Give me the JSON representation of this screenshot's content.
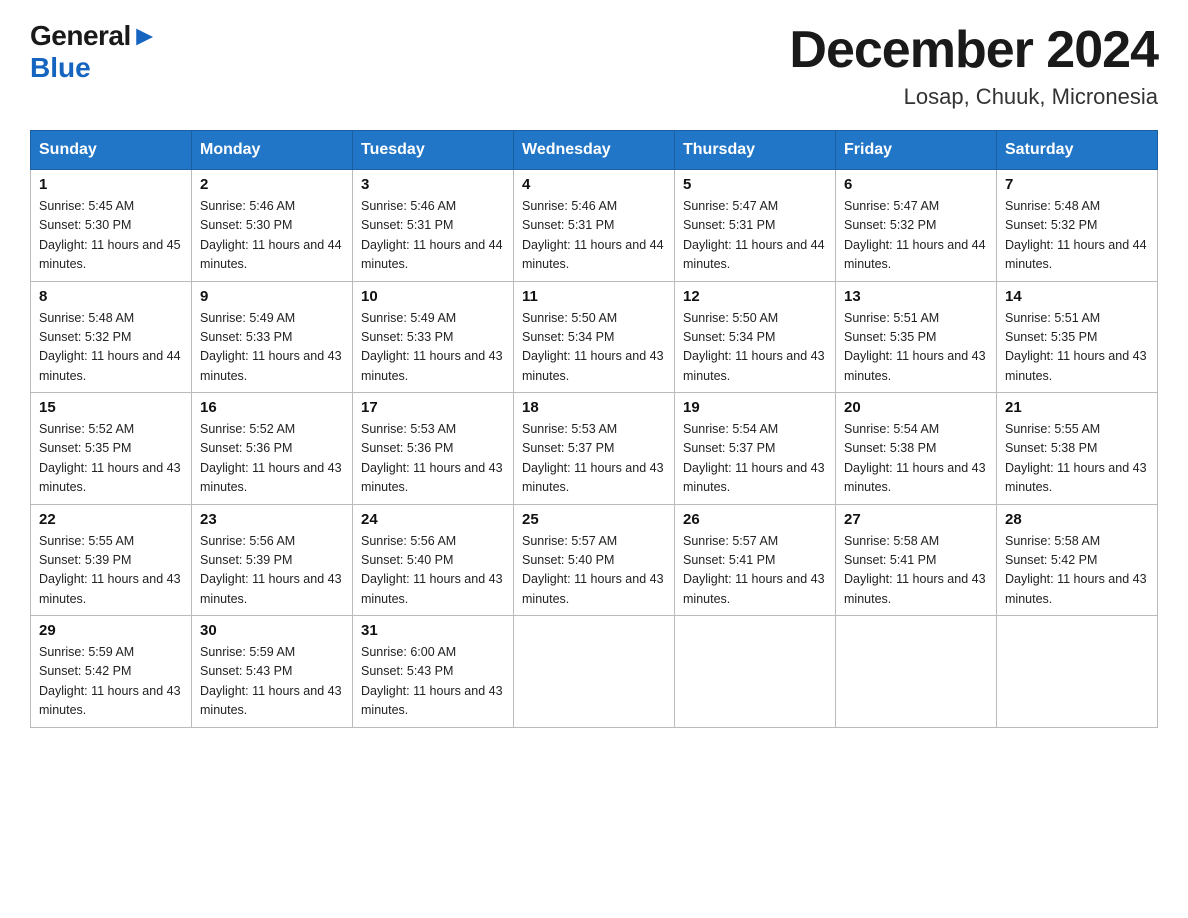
{
  "header": {
    "logo_general": "General",
    "logo_blue": "Blue",
    "month_year": "December 2024",
    "location": "Losap, Chuuk, Micronesia"
  },
  "days_of_week": [
    "Sunday",
    "Monday",
    "Tuesday",
    "Wednesday",
    "Thursday",
    "Friday",
    "Saturday"
  ],
  "weeks": [
    [
      {
        "day": "1",
        "sunrise": "5:45 AM",
        "sunset": "5:30 PM",
        "daylight": "11 hours and 45 minutes."
      },
      {
        "day": "2",
        "sunrise": "5:46 AM",
        "sunset": "5:30 PM",
        "daylight": "11 hours and 44 minutes."
      },
      {
        "day": "3",
        "sunrise": "5:46 AM",
        "sunset": "5:31 PM",
        "daylight": "11 hours and 44 minutes."
      },
      {
        "day": "4",
        "sunrise": "5:46 AM",
        "sunset": "5:31 PM",
        "daylight": "11 hours and 44 minutes."
      },
      {
        "day": "5",
        "sunrise": "5:47 AM",
        "sunset": "5:31 PM",
        "daylight": "11 hours and 44 minutes."
      },
      {
        "day": "6",
        "sunrise": "5:47 AM",
        "sunset": "5:32 PM",
        "daylight": "11 hours and 44 minutes."
      },
      {
        "day": "7",
        "sunrise": "5:48 AM",
        "sunset": "5:32 PM",
        "daylight": "11 hours and 44 minutes."
      }
    ],
    [
      {
        "day": "8",
        "sunrise": "5:48 AM",
        "sunset": "5:32 PM",
        "daylight": "11 hours and 44 minutes."
      },
      {
        "day": "9",
        "sunrise": "5:49 AM",
        "sunset": "5:33 PM",
        "daylight": "11 hours and 43 minutes."
      },
      {
        "day": "10",
        "sunrise": "5:49 AM",
        "sunset": "5:33 PM",
        "daylight": "11 hours and 43 minutes."
      },
      {
        "day": "11",
        "sunrise": "5:50 AM",
        "sunset": "5:34 PM",
        "daylight": "11 hours and 43 minutes."
      },
      {
        "day": "12",
        "sunrise": "5:50 AM",
        "sunset": "5:34 PM",
        "daylight": "11 hours and 43 minutes."
      },
      {
        "day": "13",
        "sunrise": "5:51 AM",
        "sunset": "5:35 PM",
        "daylight": "11 hours and 43 minutes."
      },
      {
        "day": "14",
        "sunrise": "5:51 AM",
        "sunset": "5:35 PM",
        "daylight": "11 hours and 43 minutes."
      }
    ],
    [
      {
        "day": "15",
        "sunrise": "5:52 AM",
        "sunset": "5:35 PM",
        "daylight": "11 hours and 43 minutes."
      },
      {
        "day": "16",
        "sunrise": "5:52 AM",
        "sunset": "5:36 PM",
        "daylight": "11 hours and 43 minutes."
      },
      {
        "day": "17",
        "sunrise": "5:53 AM",
        "sunset": "5:36 PM",
        "daylight": "11 hours and 43 minutes."
      },
      {
        "day": "18",
        "sunrise": "5:53 AM",
        "sunset": "5:37 PM",
        "daylight": "11 hours and 43 minutes."
      },
      {
        "day": "19",
        "sunrise": "5:54 AM",
        "sunset": "5:37 PM",
        "daylight": "11 hours and 43 minutes."
      },
      {
        "day": "20",
        "sunrise": "5:54 AM",
        "sunset": "5:38 PM",
        "daylight": "11 hours and 43 minutes."
      },
      {
        "day": "21",
        "sunrise": "5:55 AM",
        "sunset": "5:38 PM",
        "daylight": "11 hours and 43 minutes."
      }
    ],
    [
      {
        "day": "22",
        "sunrise": "5:55 AM",
        "sunset": "5:39 PM",
        "daylight": "11 hours and 43 minutes."
      },
      {
        "day": "23",
        "sunrise": "5:56 AM",
        "sunset": "5:39 PM",
        "daylight": "11 hours and 43 minutes."
      },
      {
        "day": "24",
        "sunrise": "5:56 AM",
        "sunset": "5:40 PM",
        "daylight": "11 hours and 43 minutes."
      },
      {
        "day": "25",
        "sunrise": "5:57 AM",
        "sunset": "5:40 PM",
        "daylight": "11 hours and 43 minutes."
      },
      {
        "day": "26",
        "sunrise": "5:57 AM",
        "sunset": "5:41 PM",
        "daylight": "11 hours and 43 minutes."
      },
      {
        "day": "27",
        "sunrise": "5:58 AM",
        "sunset": "5:41 PM",
        "daylight": "11 hours and 43 minutes."
      },
      {
        "day": "28",
        "sunrise": "5:58 AM",
        "sunset": "5:42 PM",
        "daylight": "11 hours and 43 minutes."
      }
    ],
    [
      {
        "day": "29",
        "sunrise": "5:59 AM",
        "sunset": "5:42 PM",
        "daylight": "11 hours and 43 minutes."
      },
      {
        "day": "30",
        "sunrise": "5:59 AM",
        "sunset": "5:43 PM",
        "daylight": "11 hours and 43 minutes."
      },
      {
        "day": "31",
        "sunrise": "6:00 AM",
        "sunset": "5:43 PM",
        "daylight": "11 hours and 43 minutes."
      },
      null,
      null,
      null,
      null
    ]
  ],
  "labels": {
    "sunrise": "Sunrise:",
    "sunset": "Sunset:",
    "daylight": "Daylight:"
  }
}
